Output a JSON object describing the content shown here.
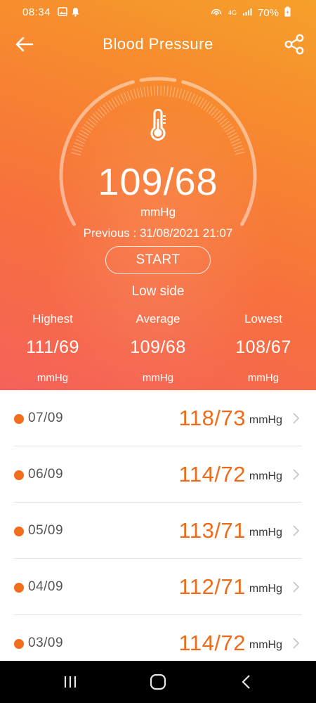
{
  "status_bar": {
    "time": "08:34",
    "network": "4G",
    "battery": "70%",
    "icons": [
      "gallery-icon",
      "notification-icon",
      "hotspot-icon",
      "signal-icon",
      "battery-icon"
    ]
  },
  "header": {
    "title": "Blood Pressure",
    "back_icon": "arrow-left-icon",
    "share_icon": "share-icon"
  },
  "measurement": {
    "value": "109/68",
    "unit": "mmHg",
    "previous": "Previous : 31/08/2021 21:07",
    "start_label": "START",
    "level": "Low side",
    "icon": "thermometer-icon"
  },
  "stats": [
    {
      "label": "Highest",
      "value": "111/69",
      "unit": "mmHg"
    },
    {
      "label": "Average",
      "value": "109/68",
      "unit": "mmHg"
    },
    {
      "label": "Lowest",
      "value": "108/67",
      "unit": "mmHg"
    }
  ],
  "history": [
    {
      "date": "07/09",
      "value": "118/73",
      "unit": "mmHg"
    },
    {
      "date": "06/09",
      "value": "114/72",
      "unit": "mmHg"
    },
    {
      "date": "05/09",
      "value": "113/71",
      "unit": "mmHg"
    },
    {
      "date": "04/09",
      "value": "112/71",
      "unit": "mmHg"
    },
    {
      "date": "03/09",
      "value": "114/72",
      "unit": "mmHg"
    }
  ],
  "nav_bar": {
    "icons": [
      "recent-apps-icon",
      "home-icon",
      "back-icon"
    ]
  },
  "colors": {
    "accent": "#ef6a1a",
    "gradient_top": "#f5a02a",
    "gradient_bottom": "#f5625a",
    "nav_background": "#000000"
  }
}
